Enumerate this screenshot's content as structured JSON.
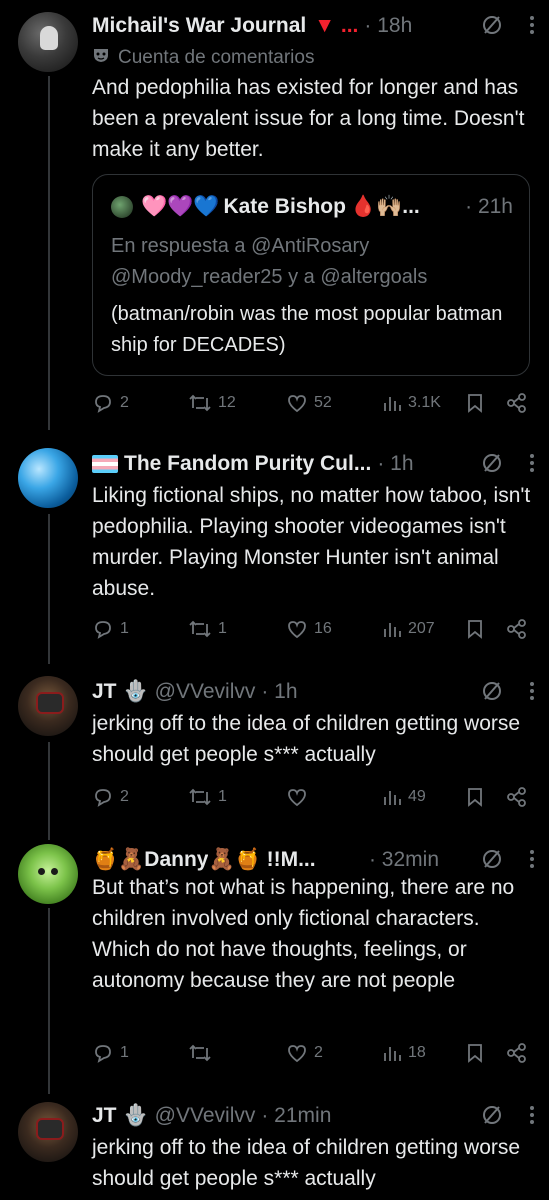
{
  "tweets": [
    {
      "name": "Michail's War Journal",
      "badge": "▼ ...",
      "time": "· 18h",
      "sub_label": "Cuenta de comentarios",
      "text": "And pedophilia has existed for longer and has been a prevalent issue for a long time. Doesn't make it any better.",
      "quote": {
        "hearts": "🩷💜💙",
        "name": "Kate Bishop",
        "badges": "🩸🙌🏼...",
        "time": "· 21h",
        "reply_prefix": "En respuesta a",
        "reply_to_1": "@AntiRosary",
        "reply_to_2": "@Moody_reader25",
        "reply_join": "y a",
        "reply_to_3": "@altergoals",
        "text": "(batman/robin was the most popular batman ship for DECADES)"
      },
      "actions": {
        "replies": "2",
        "reposts": "12",
        "likes": "52",
        "views": "3.1K"
      }
    },
    {
      "name": "The Fandom Purity Cul...",
      "time": "· 1h",
      "text": "Liking fictional ships, no matter how taboo, isn't pedophilia. Playing shooter videogames isn't murder. Playing Monster Hunter isn't animal abuse.",
      "actions": {
        "replies": "1",
        "reposts": "1",
        "likes": "16",
        "views": "207"
      }
    },
    {
      "name": "JT",
      "glyph": "🪬",
      "handle": "@VVevilvv",
      "time": "· 1h",
      "text": "jerking off to the idea of children getting worse should get people s*** actually",
      "actions": {
        "replies": "2",
        "reposts": "1",
        "likes": "",
        "views": "49"
      }
    },
    {
      "name_prefix": "🍯🧸",
      "name": "Danny",
      "name_suffix": "🧸🍯 !!M...",
      "time": "· 32min",
      "text": "But that’s not what is happening, there are no children involved only fictional characters. Which do not have thoughts, feelings, or autonomy because they are not people",
      "actions": {
        "replies": "1",
        "reposts": "",
        "likes": "2",
        "views": "18"
      }
    },
    {
      "name": "JT",
      "glyph": "🪬",
      "handle": "@VVevilvv",
      "time": "· 21min",
      "text": "jerking off to the idea of children getting worse should get people s*** actually"
    }
  ],
  "colors": {
    "background": "#000000",
    "text": "#e7e9ea",
    "muted": "#71767b",
    "border": "#2f3336",
    "name_badge_red": "#f91880"
  }
}
